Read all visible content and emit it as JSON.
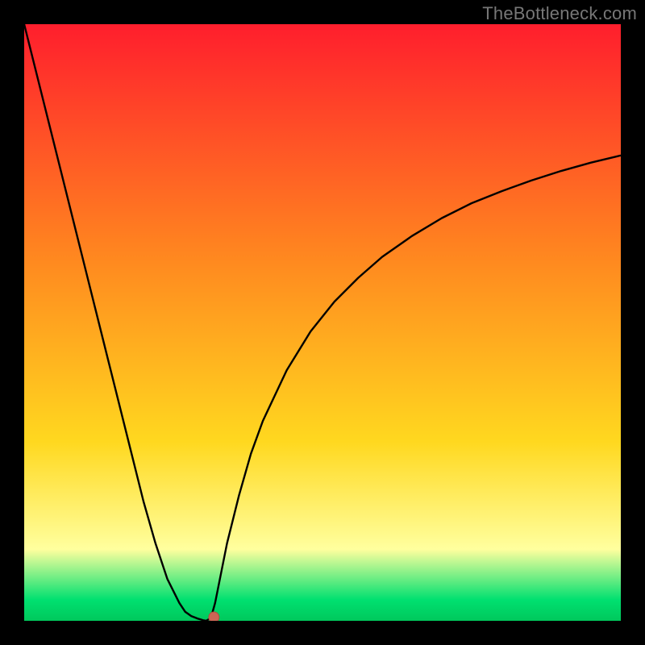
{
  "watermark": "TheBottleneck.com",
  "colors": {
    "frame": "#000000",
    "curve": "#000000",
    "marker_fill": "#cc6655",
    "marker_stroke": "#b24d3f",
    "gradient_top": "#ff1e2d",
    "gradient_mid1": "#ff8a1f",
    "gradient_mid2": "#ffd81f",
    "gradient_lightband": "#ffff9e",
    "gradient_green": "#00e070",
    "gradient_bottom": "#00c85c"
  },
  "chart_data": {
    "type": "line",
    "title": "",
    "xlabel": "",
    "ylabel": "",
    "xlim": [
      0,
      100
    ],
    "ylim": [
      0,
      100
    ],
    "x": [
      0,
      2,
      4,
      6,
      8,
      10,
      12,
      14,
      16,
      18,
      20,
      22,
      24,
      26,
      27,
      28,
      29,
      30,
      30.5,
      31,
      31.5,
      32,
      33,
      34,
      36,
      38,
      40,
      44,
      48,
      52,
      56,
      60,
      65,
      70,
      75,
      80,
      85,
      90,
      95,
      100
    ],
    "values": [
      100,
      92,
      84,
      76,
      68,
      60,
      52,
      44,
      36,
      28,
      20,
      13,
      7,
      3,
      1.5,
      0.8,
      0.4,
      0.1,
      0,
      0.3,
      1.2,
      3,
      8,
      13,
      21,
      28,
      33.5,
      42,
      48.5,
      53.5,
      57.5,
      61,
      64.5,
      67.5,
      70,
      72,
      73.8,
      75.4,
      76.8,
      78
    ],
    "flat_bottom_x_range": [
      27.5,
      30.5
    ],
    "marker": {
      "x": 31.8,
      "y": 0.6
    }
  }
}
